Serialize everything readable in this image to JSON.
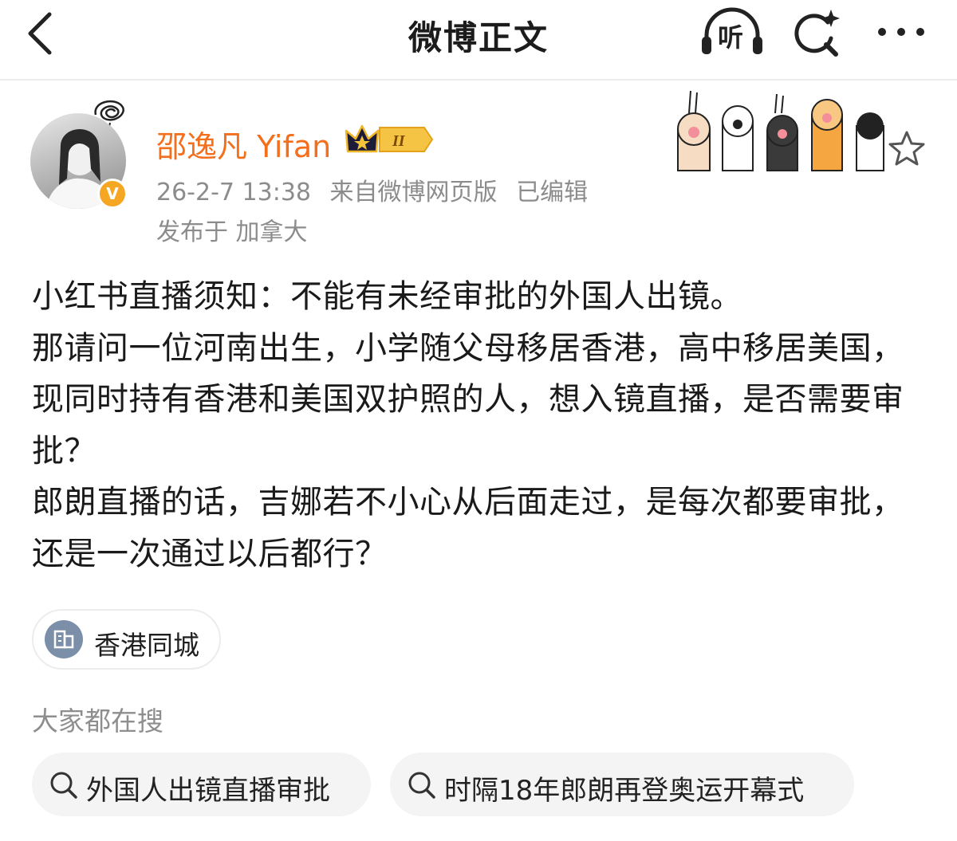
{
  "header": {
    "title": "微博正文",
    "listen_label": "听"
  },
  "author": {
    "name": "邵逸凡 Yifan",
    "verified_badge": "V",
    "vip_level": "II"
  },
  "post": {
    "timestamp": "26-2-7 13:38",
    "source": "来自微博网页版",
    "edited": "已编辑",
    "location": "发布于 加拿大",
    "paragraphs": [
      "小红书直播须知：不能有未经审批的外国人出镜。",
      "那请问一位河南出生，小学随父母移居香港，高中移居美国，现同时持有香港和美国双护照的人，想入镜直播，是否需要审批？",
      "郎朗直播的话，吉娜若不小心从后面走过，是每次都要审批，还是一次通过以后都行？"
    ]
  },
  "location_chip": {
    "label": "香港同城",
    "icon": "building-icon"
  },
  "trending": {
    "heading": "大家都在搜",
    "items": [
      "外国人出镜直播审批",
      "时隔18年郎朗再登奥运开幕式"
    ]
  },
  "colors": {
    "author_name": "#f36f1c",
    "meta_gray": "#8c8c8c",
    "verified_orange": "#f5a623",
    "pill_bg": "#f4f4f4"
  }
}
